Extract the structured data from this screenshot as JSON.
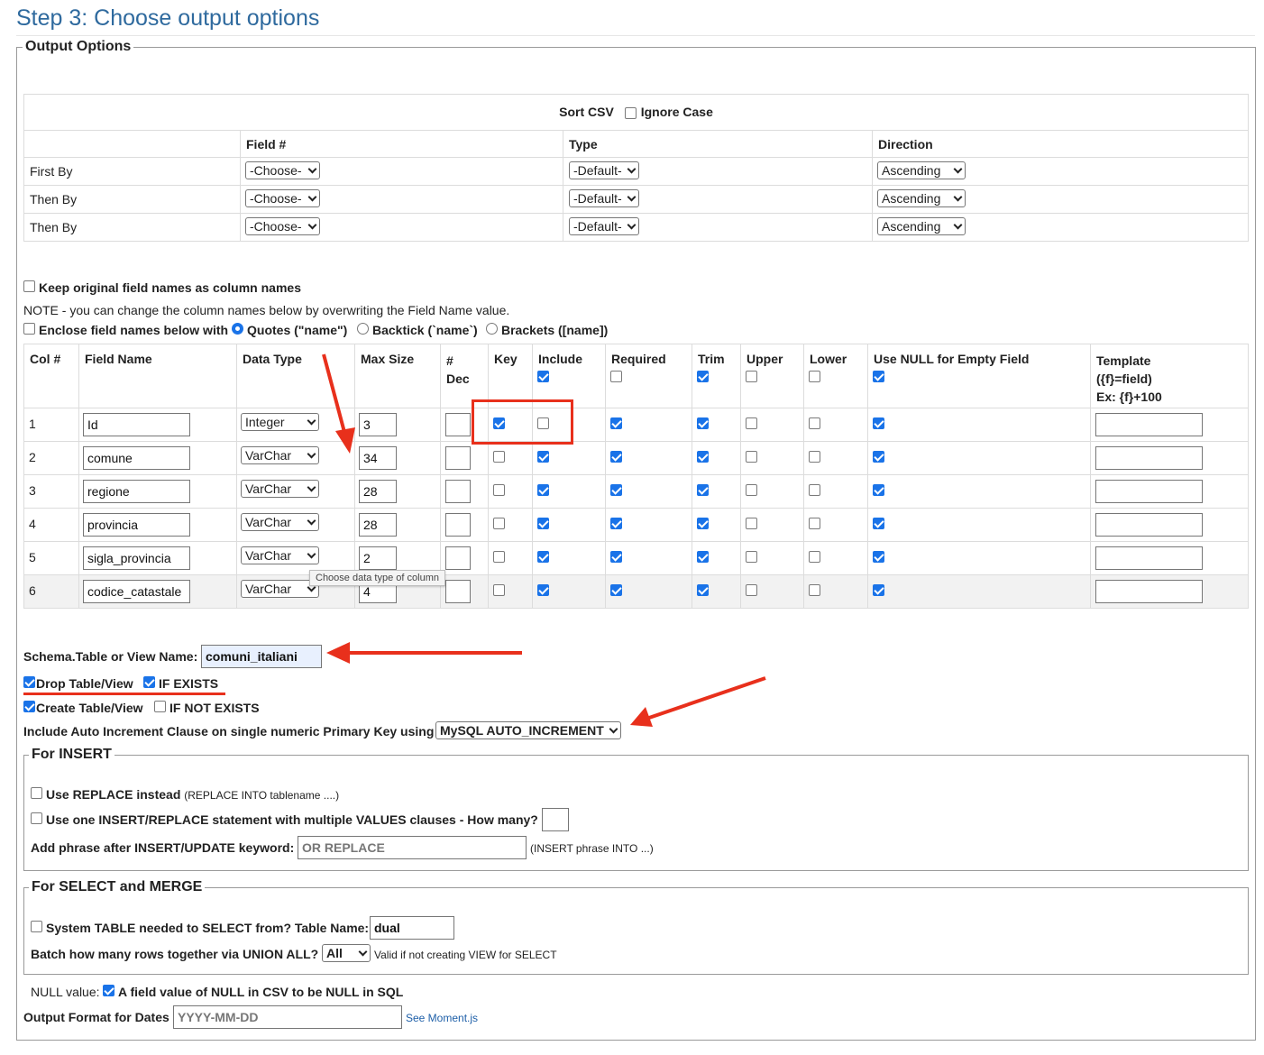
{
  "page": {
    "title": "Step 3: Choose output options"
  },
  "output_options": {
    "legend": "Output Options",
    "sort": {
      "label": "Sort CSV",
      "ignore_case_label": "Ignore Case",
      "ignore_case_checked": false,
      "headers": [
        "",
        "Field #",
        "Type",
        "Direction"
      ],
      "rows": [
        {
          "label": "First By",
          "field": "-Choose-",
          "type": "-Default-",
          "direction": "Ascending"
        },
        {
          "label": "Then By",
          "field": "-Choose-",
          "type": "-Default-",
          "direction": "Ascending"
        },
        {
          "label": "Then By",
          "field": "-Choose-",
          "type": "-Default-",
          "direction": "Ascending"
        }
      ]
    },
    "keep_original_label": "Keep original field names as column names",
    "note": "NOTE - you can change the column names below by overwriting the Field Name value.",
    "enclose": {
      "label": "Enclose field names below with",
      "options": [
        "Quotes (\"name\")",
        "Backtick (`name`)",
        "Brackets ([name])"
      ],
      "selected": 0
    },
    "fields_table": {
      "headers": {
        "col": "Col #",
        "field_name": "Field Name",
        "data_type": "Data Type",
        "max_size": "Max Size",
        "dec_line1": "#",
        "dec_line2": "Dec",
        "key": "Key",
        "include": "Include",
        "required": "Required",
        "trim": "Trim",
        "upper": "Upper",
        "lower": "Lower",
        "use_null": "Use NULL for Empty Field",
        "template_line1": "Template",
        "template_line2": "({f}=field)",
        "template_line3": "Ex: {f}+100"
      },
      "rows": [
        {
          "col": "1",
          "name": "Id",
          "type": "Integer",
          "size": "3",
          "key": true,
          "include": false,
          "required": true,
          "trim": true,
          "upper": false,
          "lower": false,
          "use_null": true
        },
        {
          "col": "2",
          "name": "comune",
          "type": "VarChar",
          "size": "34",
          "key": false,
          "include": true,
          "required": true,
          "trim": true,
          "upper": false,
          "lower": false,
          "use_null": true
        },
        {
          "col": "3",
          "name": "regione",
          "type": "VarChar",
          "size": "28",
          "key": false,
          "include": true,
          "required": true,
          "trim": true,
          "upper": false,
          "lower": false,
          "use_null": true
        },
        {
          "col": "4",
          "name": "provincia",
          "type": "VarChar",
          "size": "28",
          "key": false,
          "include": true,
          "required": true,
          "trim": true,
          "upper": false,
          "lower": false,
          "use_null": true
        },
        {
          "col": "5",
          "name": "sigla_provincia",
          "type": "VarChar",
          "size": "2",
          "key": false,
          "include": true,
          "required": true,
          "trim": true,
          "upper": false,
          "lower": false,
          "use_null": true
        },
        {
          "col": "6",
          "name": "codice_catastale",
          "type": "VarChar",
          "size": "4",
          "key": false,
          "include": true,
          "required": true,
          "trim": true,
          "upper": false,
          "lower": false,
          "use_null": true
        }
      ],
      "tooltip": "Choose data type of column"
    },
    "schema_label": "Schema.Table or View Name:",
    "schema_value": "comuni_italiani",
    "drop_table_label": "Drop Table/View",
    "if_exists_label": "IF EXISTS",
    "create_table_label": "Create Table/View",
    "if_not_exists_label": "IF NOT EXISTS",
    "auto_increment_label": "Include Auto Increment Clause on single numeric Primary Key using",
    "auto_increment_value": "MySQL AUTO_INCREMENT"
  },
  "insert": {
    "legend": "For INSERT",
    "replace_label": "Use REPLACE instead",
    "replace_hint": "(REPLACE INTO tablename ....)",
    "multi_values_label": "Use one INSERT/REPLACE statement with multiple VALUES clauses - How many?",
    "phrase_label": "Add phrase after INSERT/UPDATE keyword:",
    "phrase_placeholder": "OR REPLACE",
    "phrase_hint": "(INSERT phrase INTO ...)"
  },
  "select_merge": {
    "legend": "For SELECT and MERGE",
    "system_table_label": "System TABLE needed to SELECT from? Table Name:",
    "system_table_value": "dual",
    "batch_label": "Batch how many rows together via UNION ALL?",
    "batch_value": "All",
    "batch_hint": "Valid if not creating VIEW for SELECT"
  },
  "footer": {
    "null_label": "NULL value:",
    "null_desc": "A field value of NULL in CSV to be NULL in SQL",
    "date_label": "Output Format for Dates",
    "date_placeholder": "YYYY-MM-DD",
    "moment_link": "See Moment.js"
  },
  "colors": {
    "title": "#2f6a9e",
    "checkbox": "#1a73e8",
    "annotation": "#e8301c"
  }
}
